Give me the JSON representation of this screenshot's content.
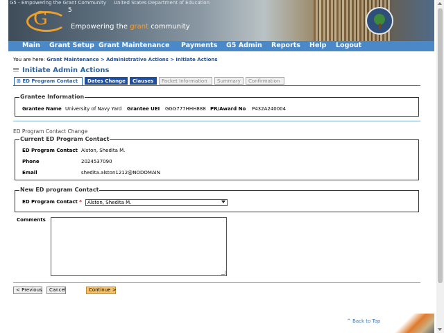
{
  "banner": {
    "alt_g5": "G5 - Empowering the Grant Community",
    "alt_ed": "United States Department of Education",
    "logo_text": "G",
    "logo_sup": "5",
    "tagline_pre": "Empowering the ",
    "tagline_hl": "grant",
    "tagline_post": " community"
  },
  "nav": {
    "items": [
      "Main",
      "Grant Setup",
      "Grant Maintenance",
      "Payments",
      "G5 Admin",
      "Reports",
      "Help",
      "Logout"
    ]
  },
  "breadcrumb": {
    "prefix": "You are here:",
    "items": [
      "Grant Maintenance",
      "Administrative Actions",
      "Initiate Actions"
    ],
    "sep": ">"
  },
  "page_title": "Initiate Admin Actions",
  "tabs": [
    {
      "label": "ED Program Contact",
      "state": "active"
    },
    {
      "label": "Dates Change",
      "state": "blue"
    },
    {
      "label": "Clauses",
      "state": "blue"
    },
    {
      "label": "Packet Information",
      "state": "gray"
    },
    {
      "label": "Summary",
      "state": "gray"
    },
    {
      "label": "Confirmation",
      "state": "gray"
    }
  ],
  "grantee": {
    "legend": "Grantee Information",
    "name_label": "Grantee Name",
    "name_value": "University of Navy Yard",
    "uei_label": "Grantee UEI",
    "uei_value": "GGG777HHH888",
    "award_label": "PR/Award No",
    "award_value": "P432A240004"
  },
  "section_note": "ED Program Contact Change",
  "current_contact": {
    "legend": "Current ED Program Contact",
    "contact_label": "ED Program Contact",
    "contact_value": "Alston, Shedita M.",
    "phone_label": "Phone",
    "phone_value": "2024537090",
    "email_label": "Email",
    "email_value": "shedita.alston1212@NODOMAIN"
  },
  "new_contact": {
    "legend": "New ED program Contact",
    "contact_label": "ED Program Contact",
    "required_mark": "*",
    "selected": "Alston, Shedita M."
  },
  "comments": {
    "label": "Comments",
    "value": ""
  },
  "buttons": {
    "previous": "< Previous",
    "cancel": "Cancel",
    "continue": "Continue >"
  },
  "back_to_top": "^ Back to Top"
}
